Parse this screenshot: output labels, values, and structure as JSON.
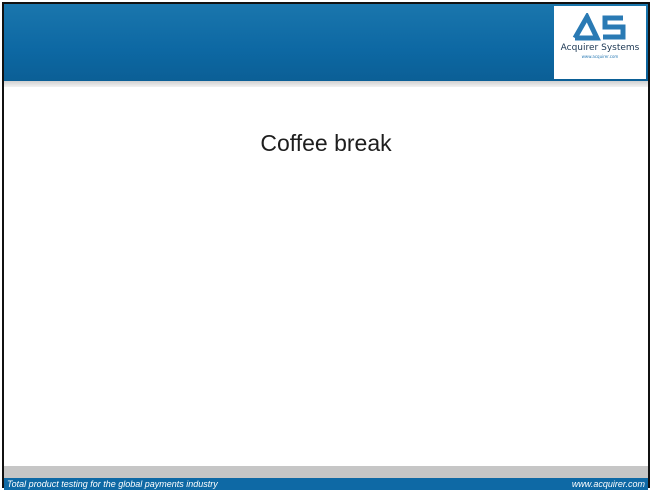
{
  "logo": {
    "mark": "AS",
    "name": "Acquirer Systems",
    "url": "www.acquirer.com"
  },
  "slide": {
    "title": "Coffee break"
  },
  "footer": {
    "tagline": "Total product testing for the global payments industry",
    "website": "www.acquirer.com"
  },
  "colors": {
    "header": "#0d68a3",
    "footer": "#0e69a5",
    "logo_mark": "#2a7ab4"
  }
}
